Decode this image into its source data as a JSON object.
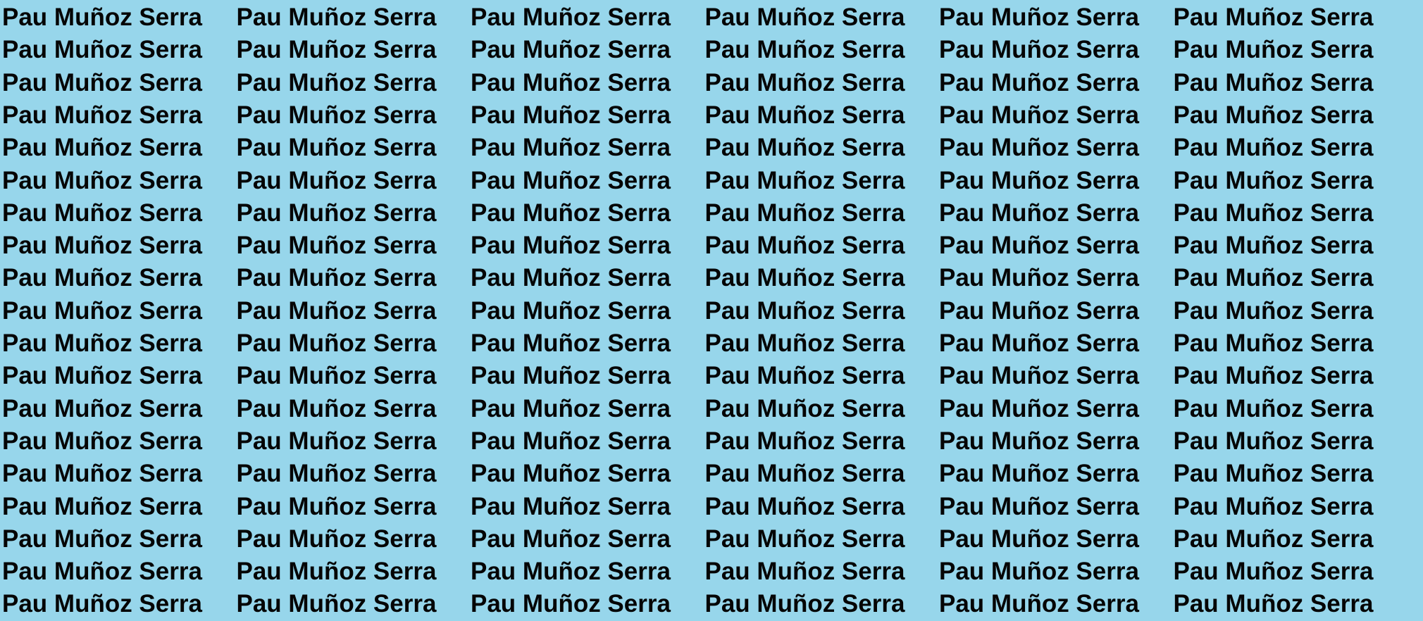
{
  "background_color": "#97d6eb",
  "text_color": "#050505",
  "pattern": {
    "text": "Pau Muñoz Serra",
    "rows": 19,
    "repeats_per_row": 6
  }
}
